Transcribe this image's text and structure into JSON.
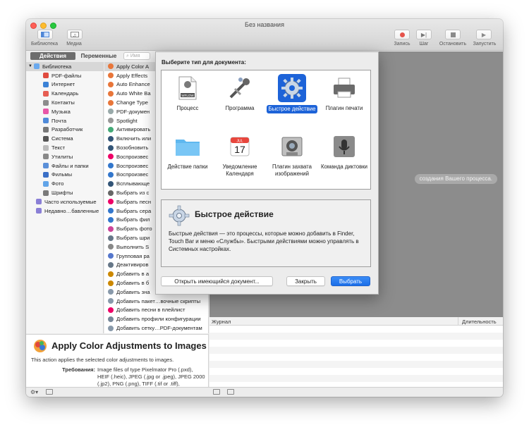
{
  "window": {
    "title": "Без названия"
  },
  "toolbar": {
    "library_label": "Библиотека",
    "media_label": "Медиа",
    "record_label": "Запись",
    "step_label": "Шаг",
    "stop_label": "Остановить",
    "run_label": "Запустить"
  },
  "tabs": {
    "actions": "Действия",
    "variables": "Переменные",
    "search_placeholder": "Имя"
  },
  "library": {
    "root": "Библиотека",
    "items": [
      "PDF-файлы",
      "Интернет",
      "Календарь",
      "Контакты",
      "Музыка",
      "Почта",
      "Разработчик",
      "Система",
      "Текст",
      "Утилиты",
      "Файлы и папки",
      "Фильмы",
      "Фото",
      "Шрифты"
    ],
    "extra": [
      "Часто используемые",
      "Недавно…бавленные"
    ]
  },
  "actions_list": [
    "Apply Color A",
    "Apply Effects",
    "Auto Enhance",
    "Auto White Ba",
    "Change Type",
    "PDF-докумен",
    "Spotlight",
    "Активировать",
    "Включить или",
    "Возобновить",
    "Воспроизвес",
    "Воспроизвес",
    "Воспроизвес",
    "Всплывающе",
    "Выбрать из с",
    "Выбрать песн",
    "Выбрать сера",
    "Выбрать фил",
    "Выбрать фото",
    "Выбрать шри",
    "Выполнить S",
    "Групповая ра",
    "Деактивиров",
    "Добавить в а",
    "Добавить в б",
    "Добавить зна",
    "Добавить пакет…вочные скрипты",
    "Добавить песни в плейлист",
    "Добавить профили конфигурации",
    "Добавить сетку…PDF-документам"
  ],
  "description": {
    "title": "Apply Color Adjustments to Images",
    "summary": "This action applies the selected color adjustments to images.",
    "requirements_label": "Требования:",
    "requirements_text": "Image files of type Pixelmator Pro (.pxd), HEIF (.heic), JPEG (.jpg or .jpeg), JPEG 2000 (.jp2), PNG (.png), TIFF (.tif or .tiff),"
  },
  "workflow": {
    "hint": "создания Вашего процесса."
  },
  "log": {
    "journal_label": "Журнал",
    "duration_label": "Длительность"
  },
  "dialog": {
    "title": "Выберите тип для документа:",
    "types": [
      {
        "label": "Процесс",
        "icon": "workflow-icon"
      },
      {
        "label": "Программа",
        "icon": "application-robot-icon"
      },
      {
        "label": "Быстрое действие",
        "icon": "gear-icon"
      },
      {
        "label": "Плагин печати",
        "icon": "printer-icon"
      },
      {
        "label": "Действие папки",
        "icon": "folder-icon"
      },
      {
        "label": "Уведомление Календаря",
        "icon": "calendar-icon"
      },
      {
        "label": "Плагин захвата изображений",
        "icon": "camera-icon"
      },
      {
        "label": "Команда диктовки",
        "icon": "microphone-icon"
      }
    ],
    "calendar_month": "JUL",
    "calendar_day": "17",
    "workflow_icon_text": "WFLOW",
    "info_title": "Быстрое действие",
    "info_text": "Быстрые действия — это процессы, которые можно добавить в Finder, Touch Bar и меню «Службы». Быстрыми действиями можно управлять в Системных настройках.",
    "open_existing": "Открыть имеющийся документ...",
    "close": "Закрыть",
    "choose": "Выбрать"
  },
  "colors": {
    "accent": "#1d63d8",
    "workflow_bg": "#8c8c8c"
  }
}
